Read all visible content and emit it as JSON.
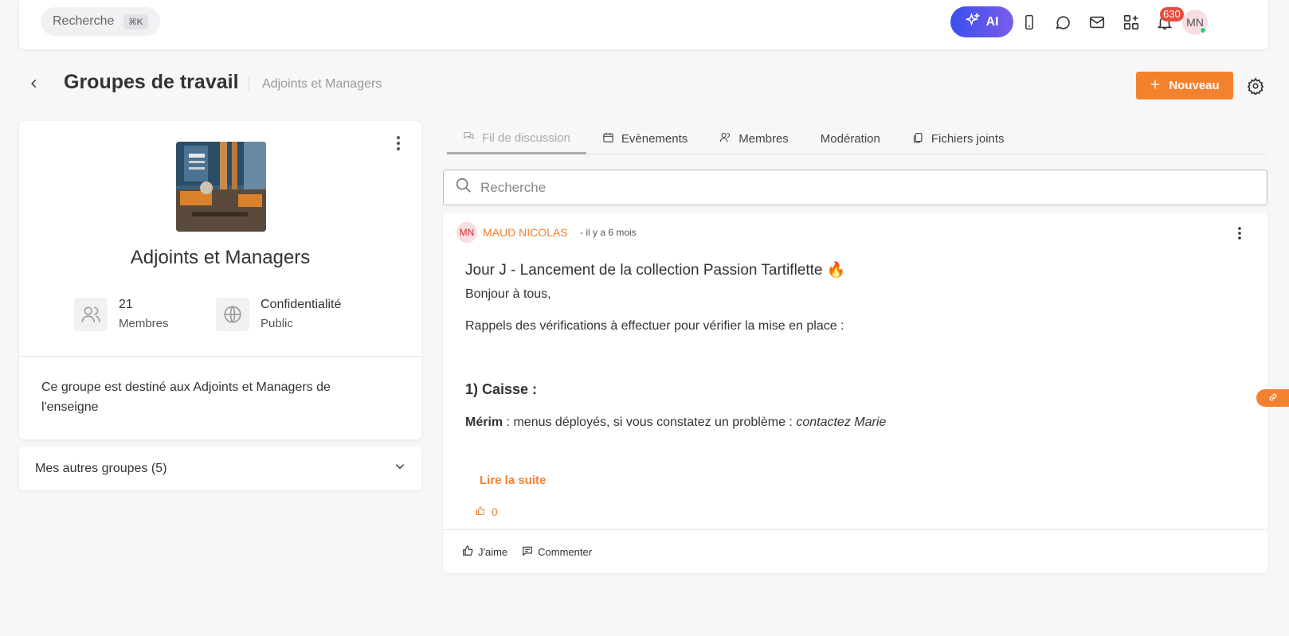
{
  "topbar": {
    "search_label": "Recherche",
    "search_shortcut": "⌘K",
    "ai_label": "AI",
    "notifications_count": "630",
    "user_initials": "MN"
  },
  "header": {
    "title": "Groupes de travail",
    "subtitle": "Adjoints et Managers",
    "new_button": "Nouveau"
  },
  "group": {
    "name": "Adjoints et Managers",
    "members_count": "21",
    "members_label": "Membres",
    "privacy_title": "Confidentialité",
    "privacy_value": "Public",
    "description": "Ce groupe est destiné aux Adjoints et Managers de l'enseigne"
  },
  "other_groups_label": "Mes autres groupes (5)",
  "tabs": [
    {
      "label": "Fil de discussion",
      "icon": "discussion-icon"
    },
    {
      "label": "Evènements",
      "icon": "calendar-icon"
    },
    {
      "label": "Membres",
      "icon": "members-icon"
    },
    {
      "label": "Modération",
      "icon": ""
    },
    {
      "label": "Fichiers joints",
      "icon": "attachment-icon"
    }
  ],
  "feed_search_placeholder": "Recherche",
  "post": {
    "avatar_initials": "MN",
    "author": "MAUD NICOLAS",
    "time": "- il y a 6 mois",
    "title": "Jour J - Lancement de la collection Passion Tartiflette 🔥",
    "greeting": "Bonjour à tous,",
    "intro": "Rappels des vérifications à effectuer pour vérifier la mise en place :",
    "section_title": "1) Caisse :",
    "item_strong": "Mérim",
    "item_text": " : menus déployés, si vous constatez un problème : ",
    "item_em": "contactez Marie",
    "read_more": "Lire la suite",
    "likes": "0",
    "like_action": "J'aime",
    "comment_action": "Commenter"
  },
  "colors": {
    "accent": "#f4812e",
    "ai_gradient_start": "#3a4ff0",
    "ai_gradient_end": "#7b5ce8",
    "badge": "#e74c3c",
    "online": "#2ecc71"
  }
}
